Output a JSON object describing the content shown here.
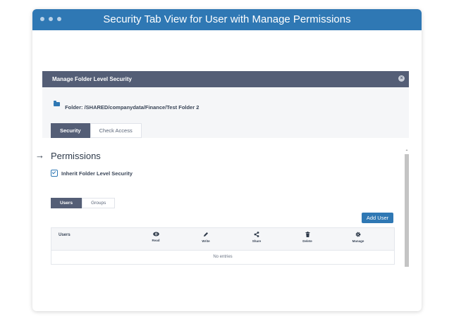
{
  "window": {
    "title": "Security Tab View for User with Manage Permissions"
  },
  "dialog": {
    "title": "Manage Folder Level Security",
    "folder_label": "Folder: /SHARED/companydata/Finance/Test Folder 2",
    "tabs": [
      "Security",
      "Check Access"
    ]
  },
  "permissions": {
    "title": "Permissions",
    "arrow": "→",
    "inherit_label": "Inherit Folder Level Security",
    "subtabs": [
      "Users",
      "Groups"
    ],
    "add_user_label": "Add User",
    "table": {
      "first_header": "Users",
      "columns": [
        {
          "label": "Read",
          "icon": "eye-icon"
        },
        {
          "label": "Write",
          "icon": "pencil-icon"
        },
        {
          "label": "Share",
          "icon": "share-icon"
        },
        {
          "label": "Delete",
          "icon": "trash-icon"
        },
        {
          "label": "Manage",
          "icon": "gear-icon"
        }
      ],
      "empty_text": "No entries"
    }
  },
  "colors": {
    "titlebar": "#2f78b4",
    "dialog_header": "#545e76",
    "accent": "#2f78b4"
  }
}
